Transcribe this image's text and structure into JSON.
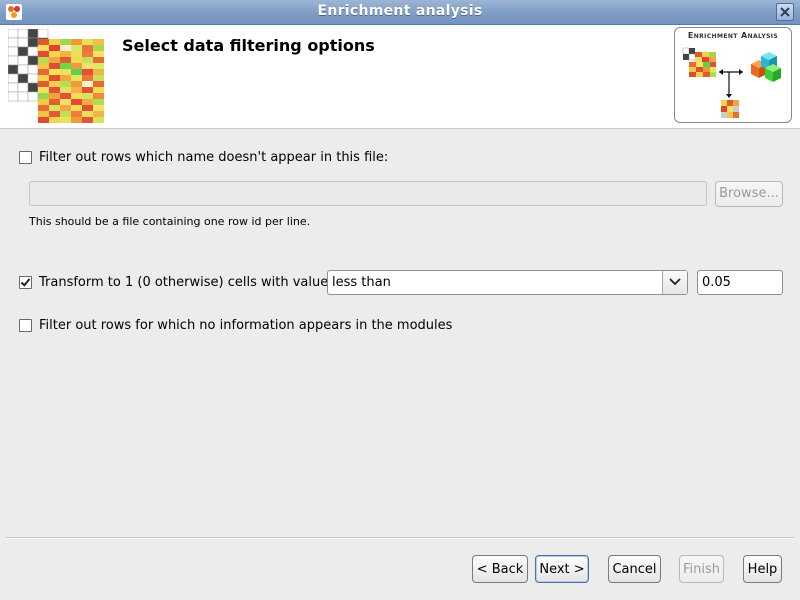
{
  "window": {
    "title": "Enrichment analysis",
    "app_icon": "app-icon",
    "close_icon": "close-icon"
  },
  "header": {
    "title": "Select data filtering options",
    "logo_text": "Enrichment Analysis"
  },
  "options": {
    "filter_file": {
      "label": "Filter out rows which name doesn't appear in this file:",
      "checked": false,
      "path_value": "",
      "browse_label": "Browse...",
      "hint": "This should be a file containing one row id per line."
    },
    "transform": {
      "label": "Transform to 1 (0 otherwise) cells with value",
      "checked": true,
      "comparison": "less than",
      "threshold": "0.05"
    },
    "filter_no_info": {
      "label": "Filter out rows for which no information appears in the modules",
      "checked": false
    }
  },
  "footer": {
    "back_label": "< Back",
    "next_label": "Next >",
    "cancel_label": "Cancel",
    "finish_label": "Finish",
    "help_label": "Help"
  }
}
